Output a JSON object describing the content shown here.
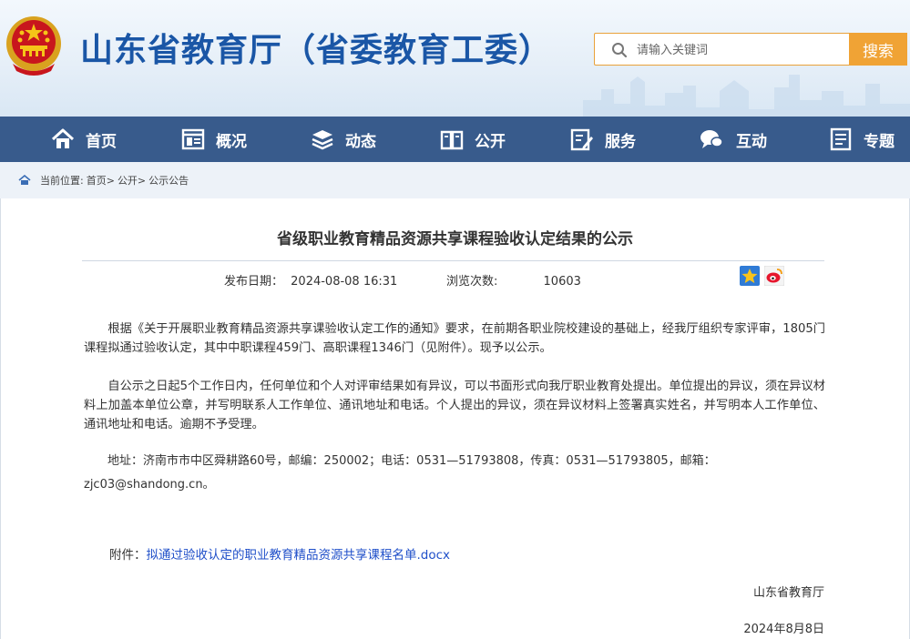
{
  "header": {
    "site_title": "山东省教育厅（省委教育工委）",
    "search_placeholder": "请输入关键词",
    "search_button": "搜索",
    "colors": {
      "brand_blue": "#1a56a6",
      "accent_orange": "#f0a335",
      "nav_bg": "#385b8c"
    }
  },
  "nav": {
    "items": [
      {
        "label": "首页",
        "icon": "home-icon"
      },
      {
        "label": "概况",
        "icon": "window-icon"
      },
      {
        "label": "动态",
        "icon": "layers-icon"
      },
      {
        "label": "公开",
        "icon": "book-icon"
      },
      {
        "label": "服务",
        "icon": "edit-icon"
      },
      {
        "label": "互动",
        "icon": "chat-icon"
      },
      {
        "label": "专题",
        "icon": "document-icon"
      }
    ]
  },
  "breadcrumb": {
    "prefix": "当前位置:",
    "items": [
      "首页>",
      "公开>",
      "公示公告"
    ]
  },
  "article": {
    "title": "省级职业教育精品资源共享课程验收认定结果的公示",
    "publish_label": "发布日期：",
    "publish_date": "2024-08-08 16:31",
    "views_label": "浏览次数:",
    "views_count": "10603",
    "paragraphs": [
      "根据《关于开展职业教育精品资源共享课验收认定工作的通知》要求，在前期各职业院校建设的基础上，经我厅组织专家评审，1805门课程拟通过验收认定，其中中职课程459门、高职课程1346门（见附件）。现予以公示。",
      "自公示之日起5个工作日内，任何单位和个人对评审结果如有异议，可以书面形式向我厅职业教育处提出。单位提出的异议，须在异议材料上加盖本单位公章，并写明联系人工作单位、通讯地址和电话。个人提出的异议，须在异议材料上签署真实姓名，并写明本人工作单位、通讯地址和电话。逾期不予受理。"
    ],
    "address": "地址：济南市市中区舜耕路60号，邮编：250002；电话：0531—51793808，传真：0531—51793805，邮箱：zjc03@shandong.cn。",
    "attachment_label": "附件：",
    "attachment_link": "拟通过验收认定的职业教育精品资源共享课程名单.docx",
    "signoff_org": "山东省教育厅",
    "signoff_date": "2024年8月8日"
  }
}
